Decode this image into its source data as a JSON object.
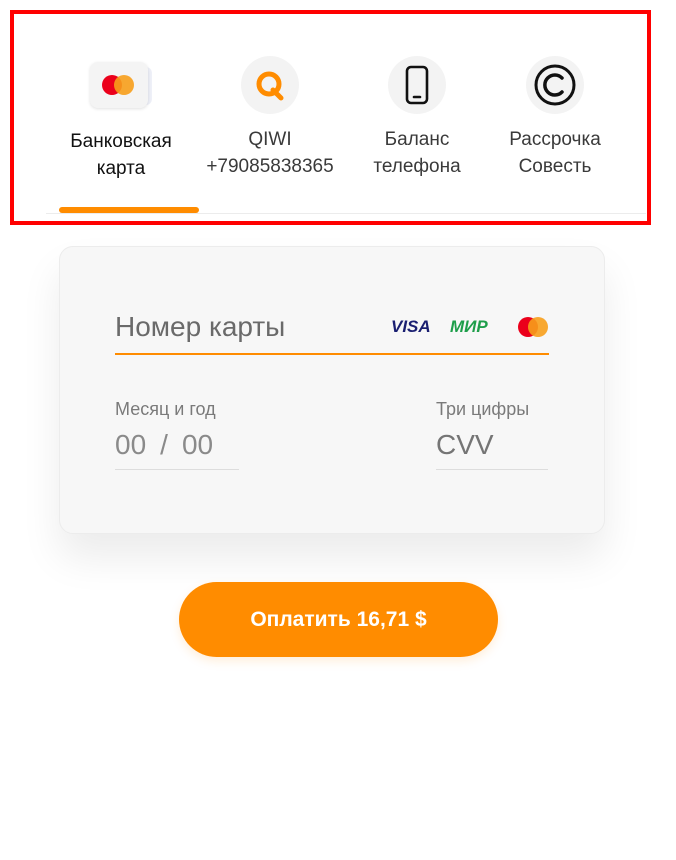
{
  "tabs": [
    {
      "label": "Банковская\nкарта",
      "icon": "bank-card-icon",
      "active": true
    },
    {
      "label": "QIWI\n+79085838365",
      "icon": "qiwi-icon",
      "active": false
    },
    {
      "label": "Баланс\nтелефона",
      "icon": "smartphone-icon",
      "active": false
    },
    {
      "label": "Рассрочка\nСовесть",
      "icon": "sovest-icon",
      "active": false
    }
  ],
  "card_form": {
    "number_placeholder": "Номер карты",
    "brands": {
      "visa": "VISA",
      "mir": "МИР",
      "mastercard": "mastercard-icon"
    },
    "expiry_label": "Месяц и год",
    "expiry_month_placeholder": "00",
    "expiry_separator": "/",
    "expiry_year_placeholder": "00",
    "cvv_label": "Три цифры",
    "cvv_placeholder": "CVV"
  },
  "pay_button": {
    "label": "Оплатить 16,71 $"
  },
  "colors": {
    "accent": "#ff8c00",
    "highlight_frame": "#ff0000",
    "mastercard_red": "#eb001b",
    "mastercard_orange": "#f79e1b",
    "qiwi_orange": "#ff8c00",
    "visa_blue": "#1a1f71",
    "mir_green": "#1e9e4a"
  }
}
